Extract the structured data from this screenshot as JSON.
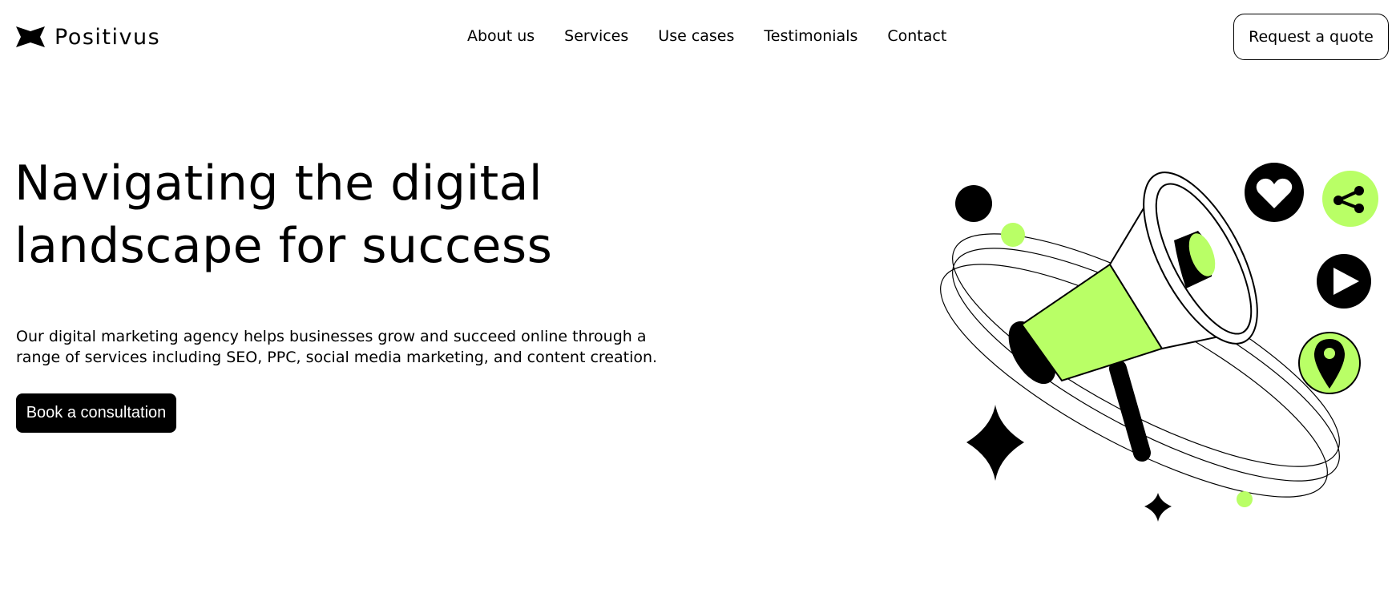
{
  "brand": {
    "name": "Positivus",
    "logo_icon": "star-logo-icon"
  },
  "nav": {
    "items": [
      {
        "label": "About us"
      },
      {
        "label": "Services"
      },
      {
        "label": "Use cases"
      },
      {
        "label": "Testimonials"
      },
      {
        "label": "Contact"
      }
    ]
  },
  "header": {
    "quote_button": "Request a quote"
  },
  "hero": {
    "title_line1": "Navigating the digital",
    "title_line2": "landscape for success",
    "description": "Our digital marketing agency helps businesses grow and succeed online through a range of services including SEO, PPC, social media marketing, and content creation.",
    "cta_label": "Book a consultation"
  },
  "illustration": {
    "icons": [
      "megaphone-icon",
      "heart-icon",
      "share-icon",
      "play-icon",
      "location-pin-icon",
      "sparkle-star-icon"
    ]
  },
  "colors": {
    "accent": "#B9FF66",
    "dark": "#000000",
    "background": "#FFFFFF"
  }
}
